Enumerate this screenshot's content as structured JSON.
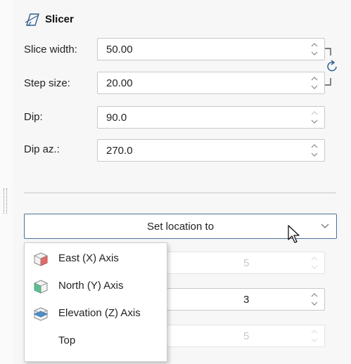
{
  "panel": {
    "title": "Slicer",
    "title_icon": "slicer-icon"
  },
  "fields": [
    {
      "label": "Slice width:",
      "value": "50.00"
    },
    {
      "label": "Step size:",
      "value": "20.00"
    },
    {
      "label": "Dip:",
      "value": "90.0"
    },
    {
      "label": "Dip az.:",
      "value": "270.0"
    }
  ],
  "link_icon": "reset-link-icon",
  "location": {
    "button_label": "Set location to",
    "hidden_fields": [
      {
        "value": "5"
      },
      {
        "value": "3"
      },
      {
        "value": "5"
      }
    ],
    "menu_items": [
      {
        "label": "East (X) Axis",
        "icon": "east-axis-cube-icon",
        "color": "#e05555"
      },
      {
        "label": "North (Y) Axis",
        "icon": "north-axis-cube-icon",
        "color": "#4caf82"
      },
      {
        "label": "Elevation (Z) Axis",
        "icon": "elevation-axis-cube-icon",
        "color": "#3d7fc4"
      },
      {
        "label": "Top",
        "icon": "",
        "color": ""
      }
    ]
  },
  "colors": {
    "accent_border": "#4c7198",
    "panel_bg": "#f7f7f7"
  }
}
